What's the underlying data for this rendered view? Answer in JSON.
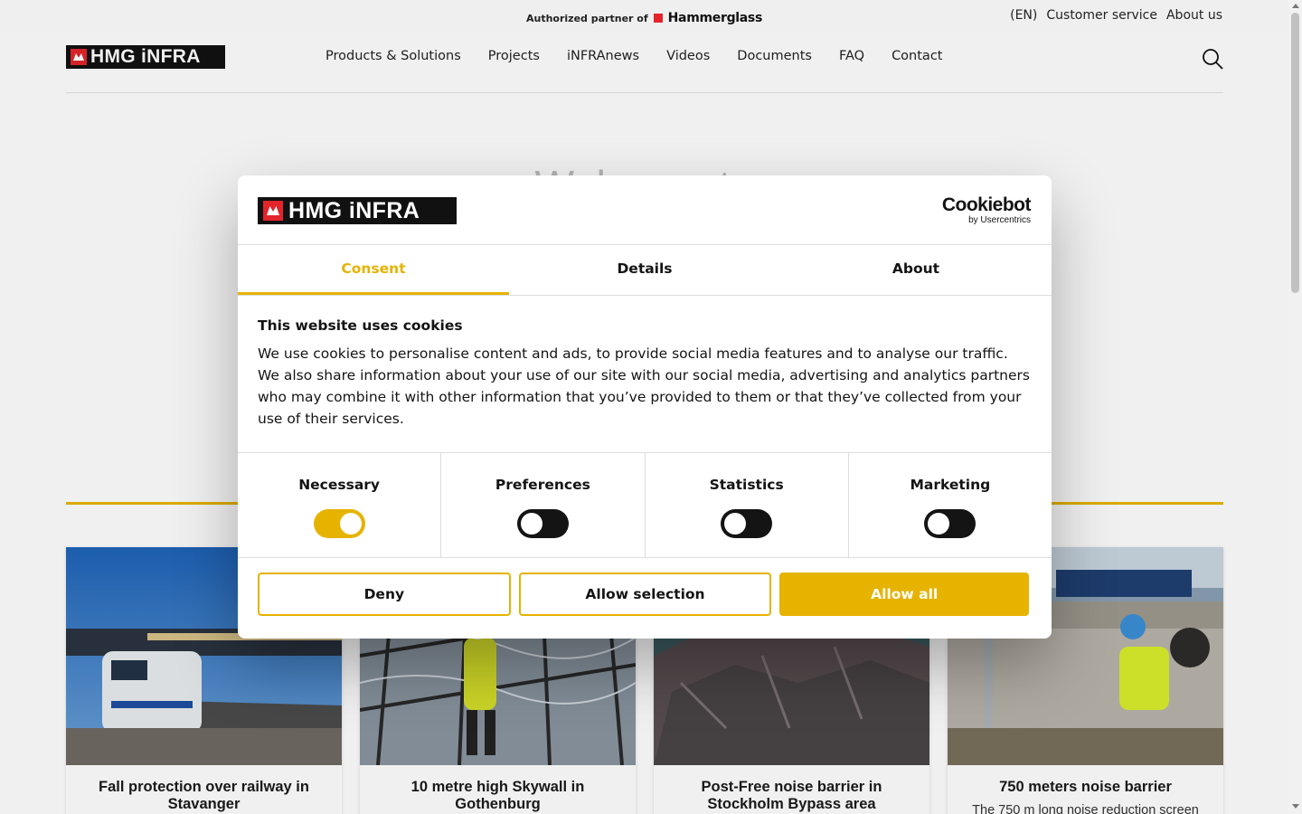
{
  "topbar": {
    "partner_prefix": "Authorized partner of",
    "partner_brand": "Hammerglass",
    "language": "(EN)",
    "customer_service": "Customer service",
    "about_us": "About us"
  },
  "header": {
    "logo_text": "HMG iNFRA",
    "nav": [
      "Products & Solutions",
      "Projects",
      "iNFRAnews",
      "Videos",
      "Documents",
      "FAQ",
      "Contact"
    ]
  },
  "hero": {
    "title": "Welcome to"
  },
  "cards": [
    {
      "title": "Fall protection over railway in Stavanger",
      "desc": ""
    },
    {
      "title": "10 metre high Skywall in Gothenburg",
      "desc": ""
    },
    {
      "title": "Post-Free noise barrier in Stockholm Bypass area",
      "desc": ""
    },
    {
      "title": "750 meters noise barrier",
      "desc": "The 750 m long noise reduction screen"
    }
  ],
  "cookie_dialog": {
    "logo_text": "HMG iNFRA",
    "provider": "Cookiebot",
    "provider_sub": "by Usercentrics",
    "tabs": [
      "Consent",
      "Details",
      "About"
    ],
    "active_tab": "Consent",
    "heading": "This website uses cookies",
    "body": "We use cookies to personalise content and ads, to provide social media features and to analyse our traffic. We also share information about your use of our site with our social media, advertising and analytics partners who may combine it with other information that you’ve provided to them or that they’ve collected from your use of their services.",
    "categories": [
      {
        "label": "Necessary",
        "enabled": true
      },
      {
        "label": "Preferences",
        "enabled": false
      },
      {
        "label": "Statistics",
        "enabled": false
      },
      {
        "label": "Marketing",
        "enabled": false
      }
    ],
    "buttons": {
      "deny": "Deny",
      "allow_selection": "Allow selection",
      "allow_all": "Allow all"
    }
  },
  "colors": {
    "accent": "#e6b300",
    "brand_red": "#e3252b",
    "dark": "#141414"
  }
}
